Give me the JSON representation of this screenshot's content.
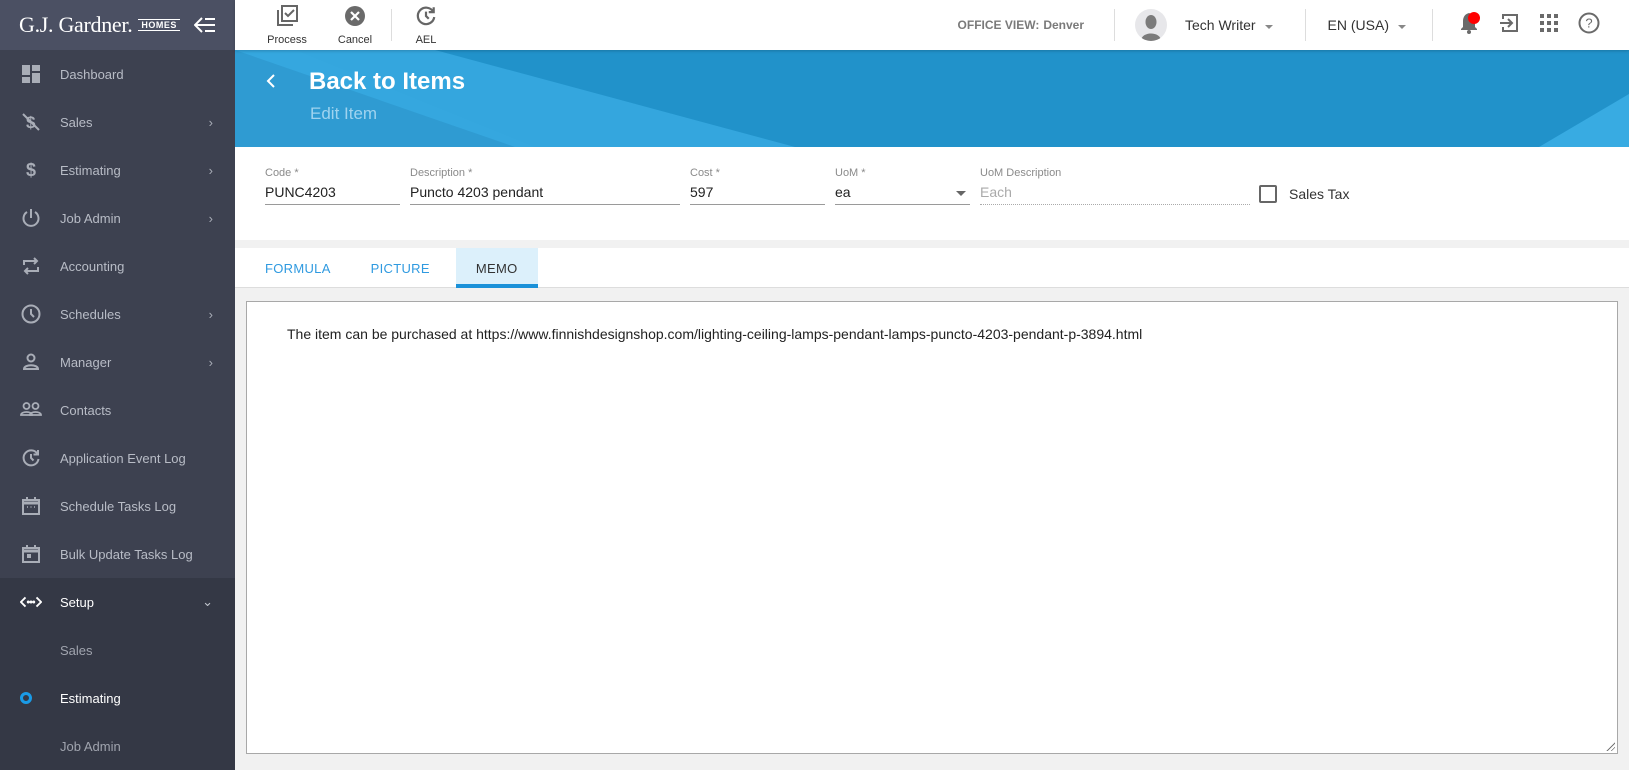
{
  "brand": {
    "name": "G.J. Gardner.",
    "sub": "HOMES"
  },
  "sidebar": {
    "items": [
      {
        "label": "Dashboard",
        "icon": "dashboard-icon",
        "has_children": false
      },
      {
        "label": "Sales",
        "icon": "sales-dollar-off-icon",
        "has_children": true
      },
      {
        "label": "Estimating",
        "icon": "dollar-icon",
        "has_children": true
      },
      {
        "label": "Job Admin",
        "icon": "power-icon",
        "has_children": true
      },
      {
        "label": "Accounting",
        "icon": "swap-arrows-icon",
        "has_children": false
      },
      {
        "label": "Schedules",
        "icon": "clock-icon",
        "has_children": true
      },
      {
        "label": "Manager",
        "icon": "person-icon",
        "has_children": true
      },
      {
        "label": "Contacts",
        "icon": "people-icon",
        "has_children": false
      },
      {
        "label": "Application Event Log",
        "icon": "history-icon",
        "has_children": false
      },
      {
        "label": "Schedule Tasks Log",
        "icon": "calendar-dots-icon",
        "has_children": false
      },
      {
        "label": "Bulk Update Tasks Log",
        "icon": "calendar-event-icon",
        "has_children": false
      }
    ],
    "setup": {
      "label": "Setup",
      "icon": "code-icon",
      "children": [
        {
          "label": "Sales"
        },
        {
          "label": "Estimating",
          "current": true
        },
        {
          "label": "Job Admin"
        }
      ]
    }
  },
  "toolbar": {
    "process_label": "Process",
    "cancel_label": "Cancel",
    "ael_label": "AEL"
  },
  "header": {
    "office_view_label": "OFFICE VIEW:",
    "office_view_value": "Denver",
    "user_name": "Tech Writer",
    "language": "EN (USA)"
  },
  "banner": {
    "back_label": "Back to Items",
    "subtitle": "Edit Item"
  },
  "form": {
    "code": {
      "label": "Code *",
      "value": "PUNC4203"
    },
    "description": {
      "label": "Description *",
      "value": "Puncto 4203 pendant"
    },
    "cost": {
      "label": "Cost *",
      "value": "597"
    },
    "uom": {
      "label": "UoM *",
      "value": "ea"
    },
    "uom_description": {
      "label": "UoM Description",
      "placeholder": "Each"
    },
    "sales_tax": {
      "label": "Sales Tax",
      "checked": false
    }
  },
  "tabs": [
    {
      "label": "FORMULA",
      "active": false
    },
    {
      "label": "PICTURE",
      "active": false
    },
    {
      "label": "MEMO",
      "active": true
    }
  ],
  "memo": {
    "text": "The item can be purchased at https://www.finnishdesignshop.com/lighting-ceiling-lamps-pendant-lamps-puncto-4203-pendant-p-3894.html"
  },
  "colors": {
    "accent": "#1a91d9",
    "sidebar_bg": "#3d4150",
    "banner_bg": "#2192ca",
    "notification_dot": "#ff0000"
  }
}
